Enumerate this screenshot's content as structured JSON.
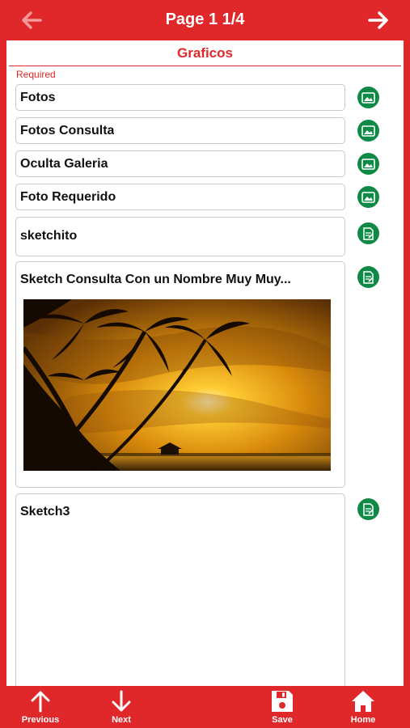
{
  "header": {
    "title": "Page 1 1/4"
  },
  "section": {
    "title": "Graficos",
    "required": "Required"
  },
  "fields": [
    {
      "label": "Fotos",
      "icon": "image-icon"
    },
    {
      "label": "Fotos Consulta",
      "icon": "image-icon"
    },
    {
      "label": "Oculta Galeria",
      "icon": "image-icon"
    },
    {
      "label": "Foto Requerido",
      "icon": "image-icon"
    },
    {
      "label": "sketchito",
      "icon": "sketch-icon"
    },
    {
      "label": "Sketch Consulta Con un Nombre Muy Muy...",
      "icon": "sketch-icon"
    },
    {
      "label": "Sketch3",
      "icon": "sketch-icon"
    }
  ],
  "footer": {
    "previous": "Previous",
    "next": "Next",
    "save": "Save",
    "home": "Home"
  },
  "colors": {
    "brand_red": "#e0282a",
    "icon_green": "#0f8a46"
  }
}
